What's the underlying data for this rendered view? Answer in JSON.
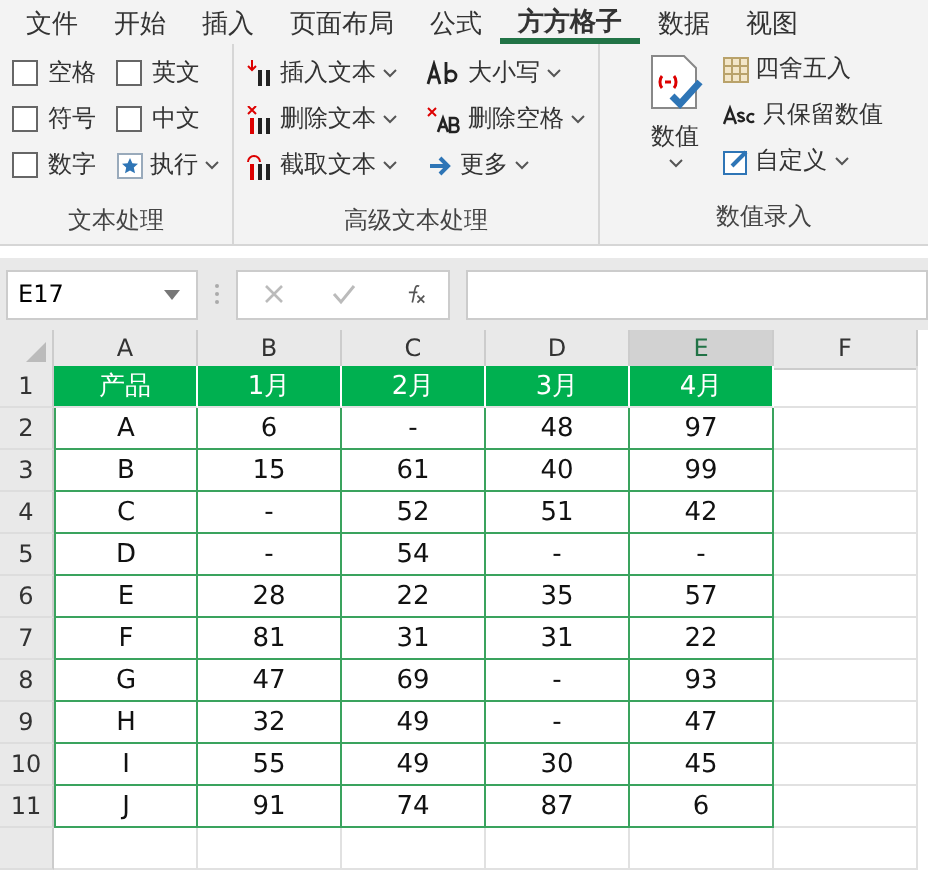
{
  "tabs": [
    {
      "label": "文件",
      "selected": false
    },
    {
      "label": "开始",
      "selected": false
    },
    {
      "label": "插入",
      "selected": false
    },
    {
      "label": "页面布局",
      "selected": false
    },
    {
      "label": "公式",
      "selected": false
    },
    {
      "label": "方方格子",
      "selected": true
    },
    {
      "label": "数据",
      "selected": false
    },
    {
      "label": "视图",
      "selected": false
    }
  ],
  "ribbon": [
    {
      "label": "文本处理",
      "items": [
        {
          "kind": "checkbox",
          "label": "空格",
          "checked": false
        },
        {
          "kind": "checkbox",
          "label": "英文",
          "checked": false
        },
        {
          "kind": "checkbox",
          "label": "符号",
          "checked": false
        },
        {
          "kind": "checkbox",
          "label": "中文",
          "checked": false
        },
        {
          "kind": "checkbox",
          "label": "数字",
          "checked": false
        },
        {
          "kind": "button",
          "label": "执行",
          "dropdown": true
        }
      ]
    },
    {
      "label": "高级文本处理",
      "items": [
        {
          "kind": "button",
          "label": "插入文本",
          "dropdown": true
        },
        {
          "kind": "button",
          "label": "删除文本",
          "dropdown": true
        },
        {
          "kind": "button",
          "label": "截取文本",
          "dropdown": true
        },
        {
          "kind": "button",
          "label": "大小写",
          "dropdown": true
        },
        {
          "kind": "button",
          "label": "删除空格",
          "dropdown": true
        },
        {
          "kind": "button",
          "label": "更多",
          "dropdown": true
        }
      ]
    },
    {
      "label": "数值录入",
      "items": [
        {
          "kind": "big",
          "label": "数值",
          "dropdown": true
        },
        {
          "kind": "button",
          "label": "四舍五入",
          "dropdown": false
        },
        {
          "kind": "button",
          "label": "只保留数值",
          "dropdown": false
        },
        {
          "kind": "button",
          "label": "自定义",
          "dropdown": true
        }
      ]
    }
  ],
  "name_box": "E17",
  "columns": [
    {
      "label": "A",
      "selected": false
    },
    {
      "label": "B",
      "selected": false
    },
    {
      "label": "C",
      "selected": false
    },
    {
      "label": "D",
      "selected": false
    },
    {
      "label": "E",
      "selected": true
    },
    {
      "label": "F",
      "selected": false
    }
  ],
  "rows": [
    {
      "number": "1",
      "kind": "header",
      "cells": [
        "产品",
        "1月",
        "2月",
        "3月",
        "4月"
      ]
    },
    {
      "number": "2",
      "kind": "data",
      "cells": [
        "A",
        "6",
        "-",
        "48",
        "97"
      ]
    },
    {
      "number": "3",
      "kind": "data",
      "cells": [
        "B",
        "15",
        "61",
        "40",
        "99"
      ]
    },
    {
      "number": "4",
      "kind": "data",
      "cells": [
        "C",
        "-",
        "52",
        "51",
        "42"
      ]
    },
    {
      "number": "5",
      "kind": "data",
      "cells": [
        "D",
        "-",
        "54",
        "-",
        "-"
      ]
    },
    {
      "number": "6",
      "kind": "data",
      "cells": [
        "E",
        "28",
        "22",
        "35",
        "57"
      ]
    },
    {
      "number": "7",
      "kind": "data",
      "cells": [
        "F",
        "81",
        "31",
        "31",
        "22"
      ]
    },
    {
      "number": "8",
      "kind": "data",
      "cells": [
        "G",
        "47",
        "69",
        "-",
        "93"
      ]
    },
    {
      "number": "9",
      "kind": "data",
      "cells": [
        "H",
        "32",
        "49",
        "-",
        "47"
      ]
    },
    {
      "number": "10",
      "kind": "data",
      "cells": [
        "I",
        "55",
        "49",
        "30",
        "45"
      ]
    },
    {
      "number": "11",
      "kind": "data",
      "cells": [
        "J",
        "91",
        "74",
        "87",
        "6"
      ]
    }
  ]
}
